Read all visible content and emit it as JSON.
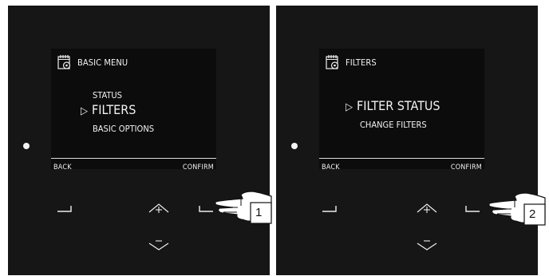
{
  "panels": [
    {
      "header_title": "BASIC MENU",
      "menu_items": [
        "STATUS",
        "FILTERS",
        "BASIC OPTIONS"
      ],
      "softkey_left": "BACK",
      "softkey_right": "CONFIRM",
      "callout_number": "1"
    },
    {
      "header_title": "FILTERS",
      "menu_items": [
        "FILTER STATUS",
        "CHANGE FILTERS"
      ],
      "softkey_left": "BACK",
      "softkey_right": "CONFIRM",
      "callout_number": "2"
    }
  ],
  "icons": {
    "menu": "calendar-gear-icon",
    "cursor": "selection-cursor-icon",
    "up": "up-arrow-plus-icon",
    "down": "down-arrow-minus-icon",
    "hand": "pointing-hand-icon"
  },
  "colors": {
    "panel": "#161616",
    "screen": "#0c0c0c",
    "text": "#f2f2f2"
  }
}
